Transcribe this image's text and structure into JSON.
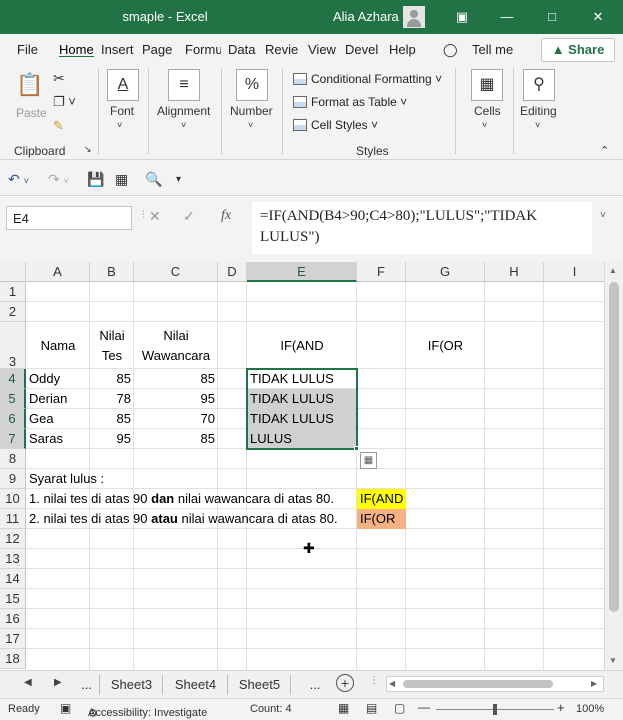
{
  "window": {
    "title": "smaple  -  Excel",
    "user": "Alia Azhara"
  },
  "tabs": [
    "File",
    "Home",
    "Insert",
    "Page",
    "Formu",
    "Data",
    "Revie",
    "View",
    "Devel",
    "Help"
  ],
  "tell_me": "Tell me",
  "share": "Share",
  "ribbon": {
    "clipboard": {
      "paste": "Paste",
      "group": "Clipboard"
    },
    "font": "Font",
    "alignment": "Alignment",
    "number": "Number",
    "styles": {
      "conditional": "Conditional Formatting",
      "format_table": "Format as Table",
      "cell_styles": "Cell Styles",
      "group": "Styles"
    },
    "cells": "Cells",
    "editing": "Editing"
  },
  "formula_bar": {
    "name_box": "E4",
    "formula_line1": "=IF(AND(B4>90;C4>80);\"LULUS\";\"TIDAK",
    "formula_line2": "LULUS\")"
  },
  "columns": [
    "A",
    "B",
    "C",
    "D",
    "E",
    "F",
    "G",
    "H",
    "I"
  ],
  "rows": [
    "1",
    "2",
    "3",
    "4",
    "5",
    "6",
    "7",
    "8",
    "9",
    "10",
    "11",
    "12",
    "13",
    "14",
    "15",
    "16",
    "17",
    "18"
  ],
  "sheet": {
    "header": {
      "nama": "Nama",
      "nilai_tes_1": "Nilai",
      "nilai_tes_2": "Tes",
      "nilai_waw_1": "Nilai",
      "nilai_waw_2": "Wawancara",
      "if_and": "IF(AND",
      "if_or": "IF(OR"
    },
    "data": [
      {
        "nama": "Oddy",
        "tes": "85",
        "waw": "85",
        "result": "TIDAK LULUS"
      },
      {
        "nama": "Derian",
        "tes": "78",
        "waw": "95",
        "result": "TIDAK LULUS"
      },
      {
        "nama": "Gea",
        "tes": "85",
        "waw": "70",
        "result": "TIDAK LULUS"
      },
      {
        "nama": "Saras",
        "tes": "95",
        "waw": "85",
        "result": "LULUS"
      }
    ],
    "syarat": "Syarat lulus :",
    "rule1_a": "1. nilai tes di atas 90 ",
    "rule1_b": "dan",
    "rule1_c": " nilai wawancara di atas 80.",
    "rule2_a": "2. nilai tes di atas 90 ",
    "rule2_b": "atau",
    "rule2_c": " nilai wawancara di atas 80.",
    "tag_and": "IF(AND",
    "tag_or": "IF(OR",
    "tag_and_color": "#ffff00",
    "tag_or_color": "#f4b183"
  },
  "sheet_tabs": [
    "...",
    "Sheet3",
    "Sheet4",
    "Sheet5",
    "..."
  ],
  "status": {
    "ready": "Ready",
    "accessibility": "Accessibility: Investigate",
    "count": "Count: 4",
    "zoom": "100%"
  },
  "accent": "#217346"
}
